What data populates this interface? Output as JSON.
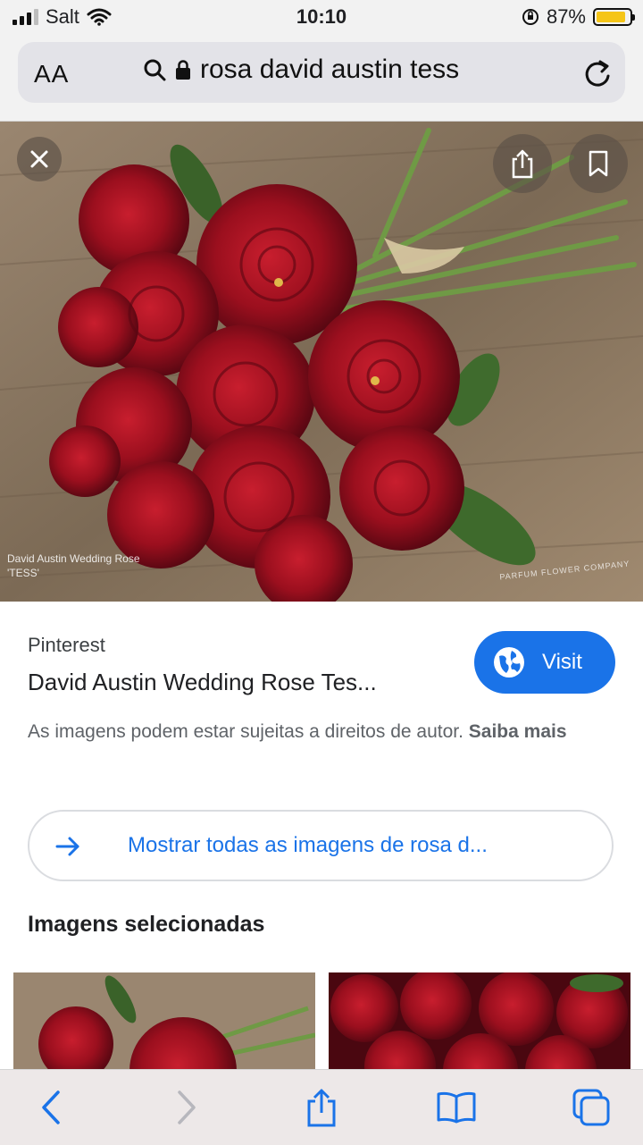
{
  "status": {
    "carrier": "Salt",
    "time": "10:10",
    "battery": "87%"
  },
  "address_bar": {
    "text_size_label": "AA",
    "url": "rosa david austin tess"
  },
  "hero": {
    "caption_line1": "David Austin Wedding Rose",
    "caption_line2": "'TESS'",
    "watermark": "PARFUM FLOWER COMPANY"
  },
  "result": {
    "source": "Pinterest",
    "title": "David Austin Wedding Rose Tes...",
    "visit_label": "Visit",
    "copyright_text": "As imagens podem estar sujeitas a direitos de autor. ",
    "learn_more": "Saiba mais"
  },
  "show_all": {
    "label": "Mostrar todas as imagens de rosa d..."
  },
  "section": {
    "title": "Imagens selecionadas"
  },
  "icons": {
    "close": "close-icon",
    "share": "share-icon",
    "bookmark": "bookmark-icon",
    "search": "search-icon",
    "lock": "lock-icon",
    "reload": "reload-icon",
    "globe": "globe-icon",
    "arrow": "arrow-right-icon",
    "back": "chevron-left-icon",
    "forward": "chevron-right-icon",
    "toolbar_share": "share-icon",
    "bookmarks": "book-icon",
    "tabs": "tabs-icon"
  },
  "colors": {
    "accent": "#1a73e8",
    "rose": "#9b0f1e",
    "battery_fill": "#f5c518"
  }
}
